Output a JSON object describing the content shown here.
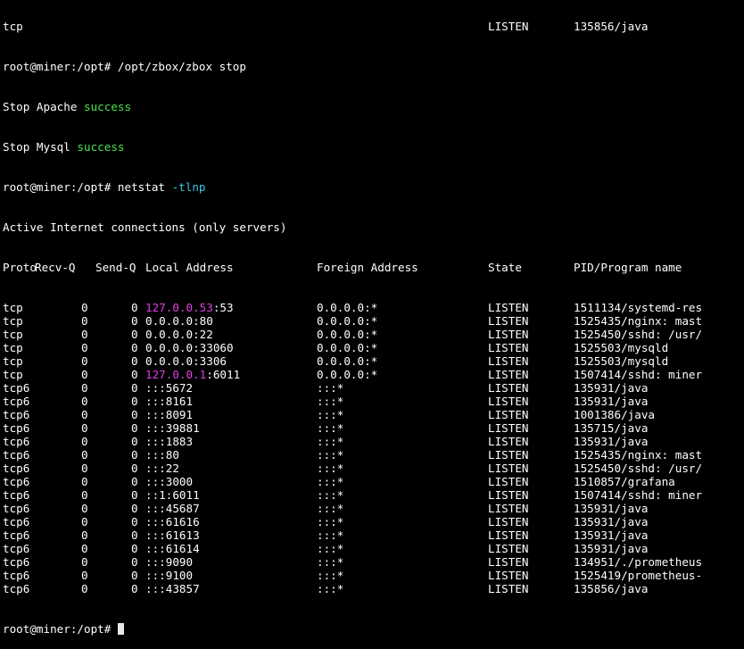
{
  "colors": {
    "background": "#000000",
    "foreground": "#ffffff",
    "success": "#4ee34e",
    "flag": "#3fc6e8",
    "loopback": "#e040e0"
  },
  "terminal": {
    "partial_top_row": {
      "proto": "tcp",
      "state": "LISTEN",
      "pid": "135856/java"
    },
    "cmd1": {
      "prompt": "root@miner:/opt# ",
      "command": "/opt/zbox/zbox stop"
    },
    "status1": {
      "text": "Stop Apache ",
      "status": "success"
    },
    "status2": {
      "text": "Stop Mysql ",
      "status": "success"
    },
    "cmd2": {
      "prompt": "root@miner:/opt# ",
      "command": "netstat ",
      "flag": "-tlnp"
    },
    "banner": "Active Internet connections (only servers)",
    "headers": {
      "proto": "Proto",
      "recvq": "Recv-Q",
      "sendq": "Send-Q",
      "local": "Local Address",
      "foreign": "Foreign Address",
      "state": "State",
      "pid": "PID/Program name"
    },
    "rows": [
      {
        "proto": "tcp",
        "recvq": "0",
        "sendq": "0",
        "local_ip": "127.0.0.53",
        "local_port": ":53",
        "foreign": "0.0.0.0:*",
        "state": "LISTEN",
        "pid": "1511134/systemd-res"
      },
      {
        "proto": "tcp",
        "recvq": "0",
        "sendq": "0",
        "local_ip": "",
        "local_port": "0.0.0.0:80",
        "foreign": "0.0.0.0:*",
        "state": "LISTEN",
        "pid": "1525435/nginx: mast"
      },
      {
        "proto": "tcp",
        "recvq": "0",
        "sendq": "0",
        "local_ip": "",
        "local_port": "0.0.0.0:22",
        "foreign": "0.0.0.0:*",
        "state": "LISTEN",
        "pid": "1525450/sshd: /usr/"
      },
      {
        "proto": "tcp",
        "recvq": "0",
        "sendq": "0",
        "local_ip": "",
        "local_port": "0.0.0.0:33060",
        "foreign": "0.0.0.0:*",
        "state": "LISTEN",
        "pid": "1525503/mysqld"
      },
      {
        "proto": "tcp",
        "recvq": "0",
        "sendq": "0",
        "local_ip": "",
        "local_port": "0.0.0.0:3306",
        "foreign": "0.0.0.0:*",
        "state": "LISTEN",
        "pid": "1525503/mysqld"
      },
      {
        "proto": "tcp",
        "recvq": "0",
        "sendq": "0",
        "local_ip": "127.0.0.1",
        "local_port": ":6011",
        "foreign": "0.0.0.0:*",
        "state": "LISTEN",
        "pid": "1507414/sshd: miner"
      },
      {
        "proto": "tcp6",
        "recvq": "0",
        "sendq": "0",
        "local_ip": "",
        "local_port": ":::5672",
        "foreign": ":::*",
        "state": "LISTEN",
        "pid": "135931/java"
      },
      {
        "proto": "tcp6",
        "recvq": "0",
        "sendq": "0",
        "local_ip": "",
        "local_port": ":::8161",
        "foreign": ":::*",
        "state": "LISTEN",
        "pid": "135931/java"
      },
      {
        "proto": "tcp6",
        "recvq": "0",
        "sendq": "0",
        "local_ip": "",
        "local_port": ":::8091",
        "foreign": ":::*",
        "state": "LISTEN",
        "pid": "1001386/java"
      },
      {
        "proto": "tcp6",
        "recvq": "0",
        "sendq": "0",
        "local_ip": "",
        "local_port": ":::39881",
        "foreign": ":::*",
        "state": "LISTEN",
        "pid": "135715/java"
      },
      {
        "proto": "tcp6",
        "recvq": "0",
        "sendq": "0",
        "local_ip": "",
        "local_port": ":::1883",
        "foreign": ":::*",
        "state": "LISTEN",
        "pid": "135931/java"
      },
      {
        "proto": "tcp6",
        "recvq": "0",
        "sendq": "0",
        "local_ip": "",
        "local_port": ":::80",
        "foreign": ":::*",
        "state": "LISTEN",
        "pid": "1525435/nginx: mast"
      },
      {
        "proto": "tcp6",
        "recvq": "0",
        "sendq": "0",
        "local_ip": "",
        "local_port": ":::22",
        "foreign": ":::*",
        "state": "LISTEN",
        "pid": "1525450/sshd: /usr/"
      },
      {
        "proto": "tcp6",
        "recvq": "0",
        "sendq": "0",
        "local_ip": "",
        "local_port": ":::3000",
        "foreign": ":::*",
        "state": "LISTEN",
        "pid": "1510857/grafana"
      },
      {
        "proto": "tcp6",
        "recvq": "0",
        "sendq": "0",
        "local_ip": "",
        "local_port": "::1:6011",
        "foreign": ":::*",
        "state": "LISTEN",
        "pid": "1507414/sshd: miner"
      },
      {
        "proto": "tcp6",
        "recvq": "0",
        "sendq": "0",
        "local_ip": "",
        "local_port": ":::45687",
        "foreign": ":::*",
        "state": "LISTEN",
        "pid": "135931/java"
      },
      {
        "proto": "tcp6",
        "recvq": "0",
        "sendq": "0",
        "local_ip": "",
        "local_port": ":::61616",
        "foreign": ":::*",
        "state": "LISTEN",
        "pid": "135931/java"
      },
      {
        "proto": "tcp6",
        "recvq": "0",
        "sendq": "0",
        "local_ip": "",
        "local_port": ":::61613",
        "foreign": ":::*",
        "state": "LISTEN",
        "pid": "135931/java"
      },
      {
        "proto": "tcp6",
        "recvq": "0",
        "sendq": "0",
        "local_ip": "",
        "local_port": ":::61614",
        "foreign": ":::*",
        "state": "LISTEN",
        "pid": "135931/java"
      },
      {
        "proto": "tcp6",
        "recvq": "0",
        "sendq": "0",
        "local_ip": "",
        "local_port": ":::9090",
        "foreign": ":::*",
        "state": "LISTEN",
        "pid": "134951/./prometheus"
      },
      {
        "proto": "tcp6",
        "recvq": "0",
        "sendq": "0",
        "local_ip": "",
        "local_port": ":::9100",
        "foreign": ":::*",
        "state": "LISTEN",
        "pid": "1525419/prometheus-"
      },
      {
        "proto": "tcp6",
        "recvq": "0",
        "sendq": "0",
        "local_ip": "",
        "local_port": ":::43857",
        "foreign": ":::*",
        "state": "LISTEN",
        "pid": "135856/java"
      }
    ],
    "final_prompt": "root@miner:/opt# "
  }
}
